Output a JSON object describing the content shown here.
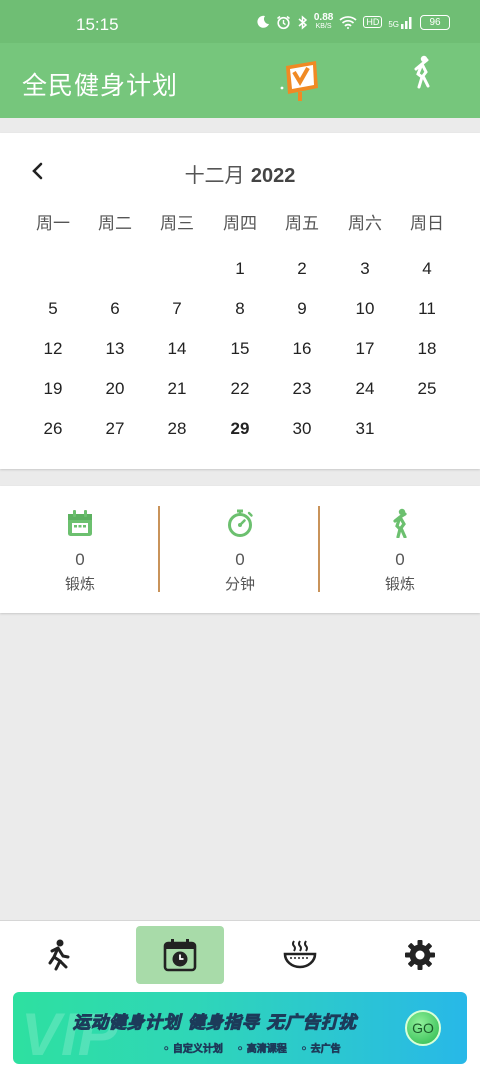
{
  "status_bar": {
    "time": "15:15",
    "net_speed_value": "0.88",
    "net_speed_unit": "KB/S",
    "hd_label": "HD",
    "signal_label": "5G",
    "battery": "96"
  },
  "app_bar": {
    "title": "全民健身计划"
  },
  "calendar": {
    "month_label": "十二月",
    "year_label": "2022",
    "weekdays": [
      "周一",
      "周二",
      "周三",
      "周四",
      "周五",
      "周六",
      "周日"
    ],
    "days": [
      "1",
      "2",
      "3",
      "4",
      "5",
      "6",
      "7",
      "8",
      "9",
      "10",
      "11",
      "12",
      "13",
      "14",
      "15",
      "16",
      "17",
      "18",
      "19",
      "20",
      "21",
      "22",
      "23",
      "24",
      "25",
      "26",
      "27",
      "28",
      "29",
      "30",
      "31"
    ],
    "today": "29"
  },
  "stats": [
    {
      "icon": "calendar-icon",
      "value": "0",
      "label": "锻炼"
    },
    {
      "icon": "stopwatch-icon",
      "value": "0",
      "label": "分钟"
    },
    {
      "icon": "walker-icon",
      "value": "0",
      "label": "锻炼"
    }
  ],
  "bottom_nav": [
    {
      "icon": "runner-icon",
      "active": false
    },
    {
      "icon": "calendar-clock-icon",
      "active": true
    },
    {
      "icon": "food-bowl-icon",
      "active": false
    },
    {
      "icon": "gear-icon",
      "active": false
    }
  ],
  "ad": {
    "headline": "运动健身计划  健身指导  无广告打扰",
    "features": [
      "自定义计划",
      "高清课程",
      "去广告"
    ],
    "go_label": "GO"
  },
  "colors": {
    "app_bar": "#76c67c",
    "status_bar": "#6fbe74",
    "icon_green": "#6cc06f",
    "divider": "#c9935a",
    "active_tab": "#a8dba9"
  }
}
